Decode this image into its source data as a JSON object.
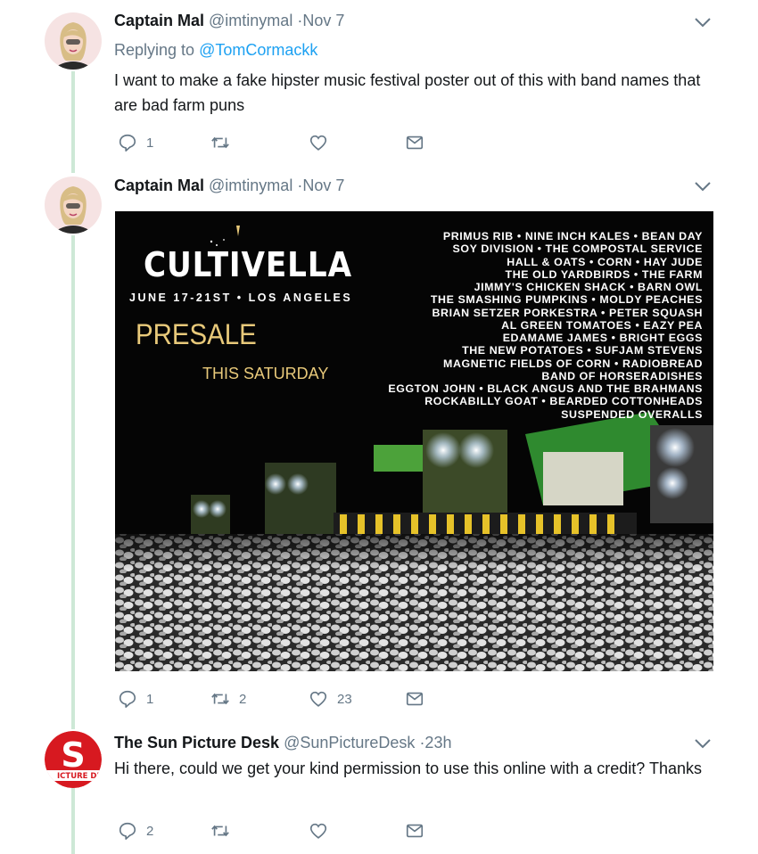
{
  "tweets": [
    {
      "name": "Captain Mal",
      "handle": "@imtinymal",
      "time": "·Nov 7",
      "replying_prefix": "Replying to ",
      "replying_to": "@TomCormackk",
      "text": "I want to make a fake hipster music festival poster out of this with band names that are bad farm puns",
      "counts": {
        "reply": "1",
        "retweet": "",
        "like": ""
      }
    },
    {
      "name": "Captain Mal",
      "handle": "@imtinymal",
      "time": "·Nov 7",
      "counts": {
        "reply": "1",
        "retweet": "2",
        "like": "23"
      },
      "poster": {
        "title": "CULTIVELLA",
        "date": "JUNE 17-21ST • LOS ANGELES",
        "presale": "PRESALE",
        "saturday": "THIS SATURDAY",
        "lineup": [
          "PRIMUS RIB • NINE INCH KALES • BEAN DAY",
          "SOY DIVISION • THE COMPOSTAL SERVICE",
          "HALL & OATS • CORN • HAY JUDE",
          "THE OLD YARDBIRDS • THE FARM",
          "JIMMY'S CHICKEN SHACK • BARN OWL",
          "THE SMASHING PUMPKINS • MOLDY PEACHES",
          "BRIAN SETZER PORKESTRA • PETER SQUASH",
          "AL GREEN TOMATOES • EAZY PEA",
          "EDAMAME JAMES • BRIGHT EGGS",
          "THE NEW POTATOES • SUFJAM STEVENS",
          "MAGNETIC FIELDS OF CORN • RADIOBREAD",
          "BAND OF HORSERADISHES",
          "EGGTON JOHN • BLACK ANGUS AND THE BRAHMANS",
          "ROCKABILLY GOAT • BEARDED COTTONHEADS",
          "SUSPENDED OVERALLS"
        ]
      }
    },
    {
      "name": "The Sun Picture Desk",
      "handle": "@SunPictureDesk",
      "time": "·23h",
      "avatar_letter": "S",
      "avatar_text": "ICTURE DES",
      "text": "Hi there, could we get your kind permission to use this online with a credit? Thanks",
      "counts": {
        "reply": "2",
        "retweet": "",
        "like": ""
      }
    }
  ],
  "colors": {
    "link": "#1da1f2",
    "muted": "#657786",
    "thread_line": "#cde8d6",
    "sun_red": "#d71920"
  },
  "icons": [
    "reply-icon",
    "retweet-icon",
    "like-icon",
    "direct-message-icon",
    "chevron-down-icon"
  ]
}
